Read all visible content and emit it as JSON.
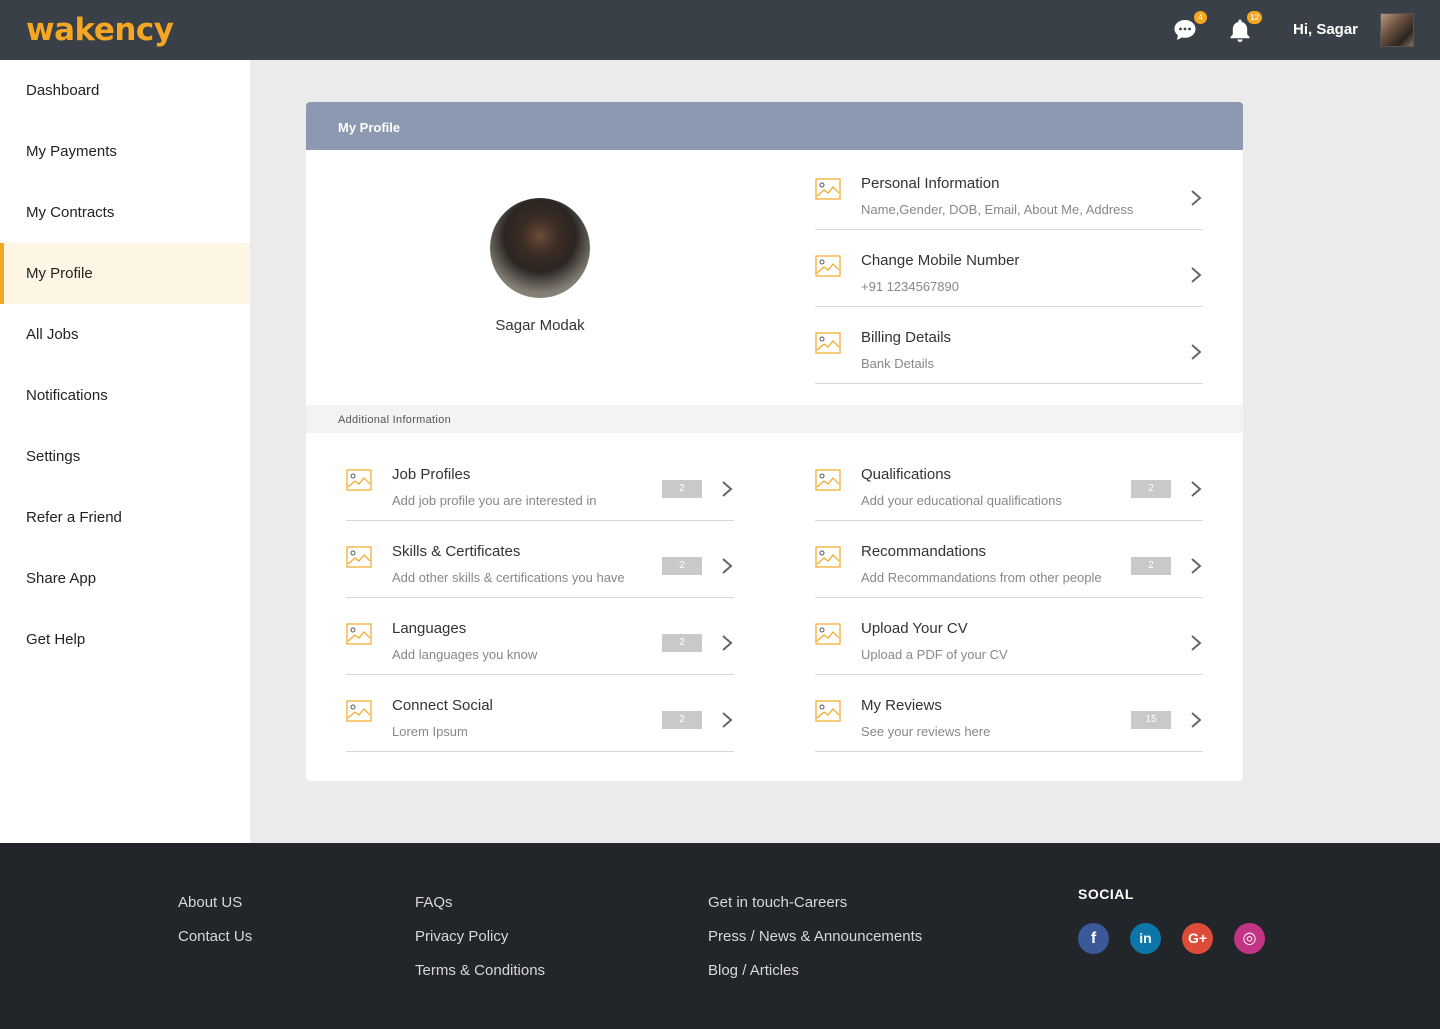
{
  "header": {
    "logo": "wakency",
    "chat_badge": "4",
    "notif_badge": "12",
    "greeting": "Hi, Sagar"
  },
  "sidebar": {
    "items": [
      {
        "label": "Dashboard"
      },
      {
        "label": "My Payments"
      },
      {
        "label": "My Contracts"
      },
      {
        "label": "My Profile"
      },
      {
        "label": "All Jobs"
      },
      {
        "label": "Notifications"
      },
      {
        "label": "Settings"
      },
      {
        "label": "Refer a Friend"
      },
      {
        "label": "Share App"
      },
      {
        "label": "Get Help"
      }
    ],
    "active": "My Profile"
  },
  "profile": {
    "title": "My Profile",
    "name": "Sagar Modak",
    "primary": [
      {
        "title": "Personal Information",
        "sub": "Name,Gender, DOB, Email, About Me, Address"
      },
      {
        "title": "Change Mobile Number",
        "sub": "+91 1234567890"
      },
      {
        "title": "Billing Details",
        "sub": "Bank Details"
      }
    ],
    "additional_label": "Additional Information",
    "additional_left": [
      {
        "title": "Job Profiles",
        "sub": "Add job profile you are interested in",
        "count": "2"
      },
      {
        "title": "Skills & Certificates",
        "sub": "Add other skills & certifications you have",
        "count": "2"
      },
      {
        "title": "Languages",
        "sub": "Add languages you know",
        "count": "2"
      },
      {
        "title": "Connect Social",
        "sub": "Lorem Ipsum",
        "count": "2"
      }
    ],
    "additional_right": [
      {
        "title": "Qualifications",
        "sub": "Add your educational qualifications",
        "count": "2"
      },
      {
        "title": "Recommandations",
        "sub": "Add Recommandations from other people",
        "count": "2"
      },
      {
        "title": "Upload Your CV",
        "sub": "Upload a PDF of your CV",
        "count": ""
      },
      {
        "title": "My Reviews",
        "sub": "See your reviews here",
        "count": "15"
      }
    ]
  },
  "footer": {
    "col1": [
      "About US",
      "Contact Us"
    ],
    "col2": [
      "FAQs",
      "Privacy Policy",
      "Terms & Conditions"
    ],
    "col3": [
      "Get in touch-Careers",
      "Press / News & Announcements",
      "Blog / Articles"
    ],
    "social_title": "SOCIAL",
    "social": [
      {
        "icon": "facebook-icon",
        "glyph": "f",
        "color": "#3b5998"
      },
      {
        "icon": "linkedin-icon",
        "glyph": "in",
        "color": "#0e76a8"
      },
      {
        "icon": "google-plus-icon",
        "glyph": "G+",
        "color": "#dd4b39"
      },
      {
        "icon": "instagram-icon",
        "glyph": "◎",
        "color": "#c13584"
      }
    ]
  },
  "colors": {
    "accent": "#f5a623",
    "header_bg": "#3a4047",
    "card_header": "#8c99b1",
    "footer_bg": "#222529"
  }
}
